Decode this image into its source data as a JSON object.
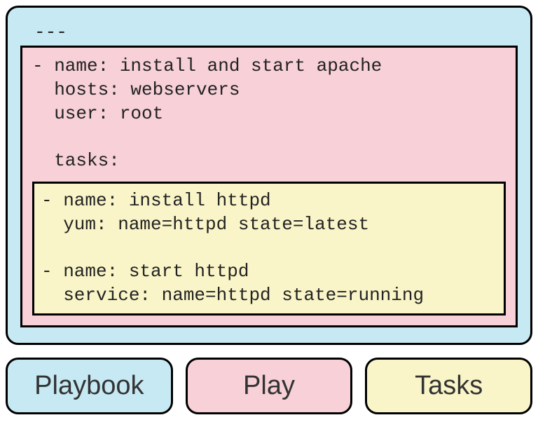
{
  "colors": {
    "playbook": "#c6e9f3",
    "play": "#f7d0d8",
    "tasks": "#f9f5c8"
  },
  "code": {
    "header": "---",
    "play": {
      "line1": "- name: install and start apache",
      "line2": "  hosts: webservers",
      "line3": "  user: root",
      "blank1": "",
      "line4": "  tasks:"
    },
    "tasks": {
      "line1": "- name: install httpd",
      "line2": "  yum: name=httpd state=latest",
      "blank1": "",
      "line3": "- name: start httpd",
      "line4": "  service: name=httpd state=running"
    }
  },
  "legend": {
    "playbook": "Playbook",
    "play": "Play",
    "tasks": "Tasks"
  }
}
